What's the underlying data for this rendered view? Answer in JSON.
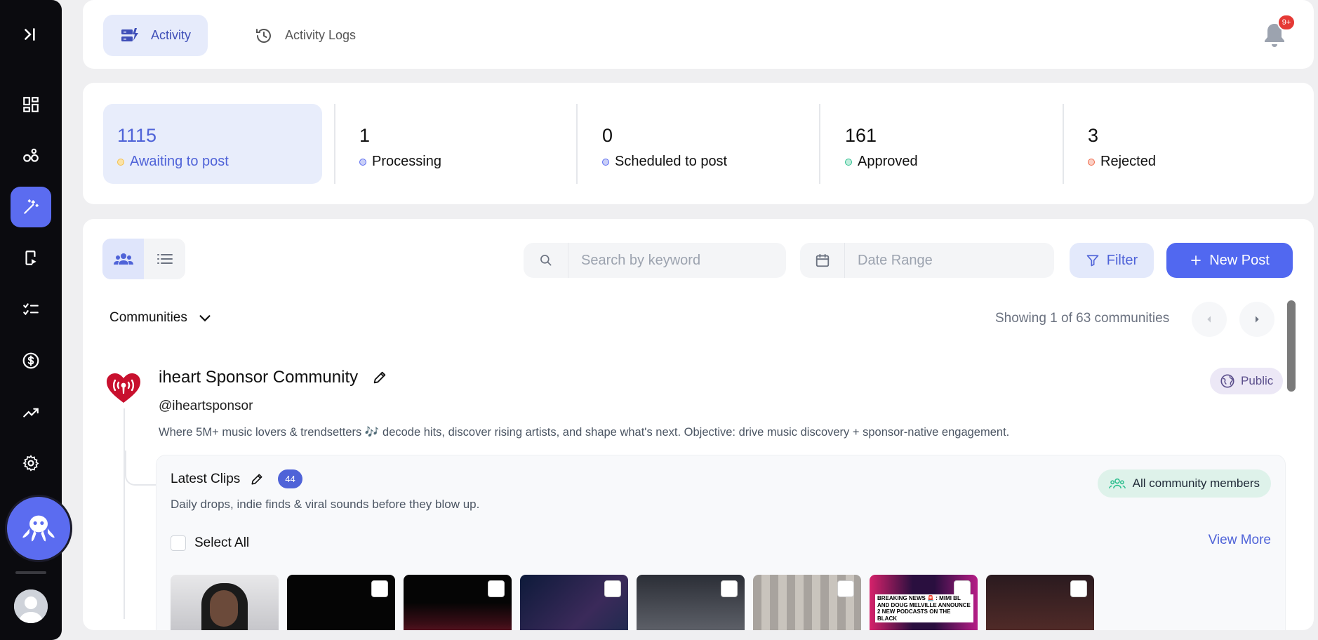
{
  "tabs": {
    "activity": "Activity",
    "activity_logs": "Activity Logs"
  },
  "notifications": {
    "badge": "9+"
  },
  "stats": [
    {
      "value": "1115",
      "label": "Awaiting to post",
      "color": "#f5c04a"
    },
    {
      "value": "1",
      "label": "Processing",
      "color": "#5b6cf0"
    },
    {
      "value": "0",
      "label": "Scheduled to post",
      "color": "#5b6cf0"
    },
    {
      "value": "161",
      "label": "Approved",
      "color": "#2fbf8f"
    },
    {
      "value": "3",
      "label": "Rejected",
      "color": "#ef6a4a"
    }
  ],
  "toolbar": {
    "search_placeholder": "Search by keyword",
    "date_placeholder": "Date Range",
    "filter_label": "Filter",
    "new_post_label": "New Post"
  },
  "communities": {
    "dropdown_label": "Communities",
    "showing": "Showing 1 of 63 communities"
  },
  "community": {
    "name": "iheart Sponsor Community",
    "handle": "@iheartsponsor",
    "description": "Where 5M+ music lovers & trendsetters 🎶 decode hits, discover rising artists, and shape what's next. Objective: drive music discovery + sponsor-native engagement.",
    "visibility": "Public",
    "brand_color": "#c8102e"
  },
  "channel": {
    "title": "Latest Clips",
    "count": "44",
    "description": "Daily drops, indie finds & viral sounds before they blow up.",
    "audience": "All community members",
    "select_all": "Select All",
    "view_more": "View More",
    "thumb_caption": "BREAKING NEWS 🚨 : MIMI BL AND DOUG MELVILLE ANNOUNCE 2 NEW PODCASTS ON THE BLACK"
  }
}
